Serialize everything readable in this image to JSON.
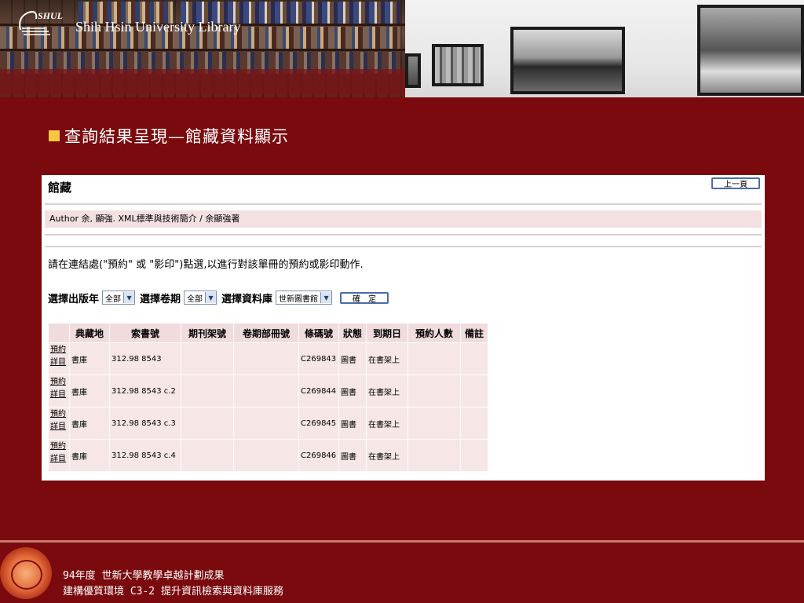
{
  "banner": {
    "library_name": "Shih Hsin University Library",
    "logo_text": "SHUL"
  },
  "heading": "查詢結果呈現—館藏資料顯示",
  "panel": {
    "title": "館藏",
    "prev_button": "上一頁",
    "author_line": "Author 余, 顯強.  XML標準與技術簡介 / 余顯強著",
    "instruction": "請在連結處(\"預約\" 或 \"影印\")點選,以進行對該單冊的預約或影印動作.",
    "filters": {
      "year_label": "選擇出版年",
      "year_value": "全部",
      "volume_label": "選擇卷期",
      "volume_value": "全部",
      "database_label": "選擇資料庫",
      "database_value": "世新圖書館",
      "ok_button": "確　定"
    },
    "table": {
      "headers": [
        "",
        "典藏地",
        "索書號",
        "期刊架號",
        "卷期部冊號",
        "條碼號",
        "狀態",
        "到期日",
        "預約人數",
        "備註"
      ],
      "rows": [
        {
          "reserve": "預約",
          "detail": "詳目",
          "location": "書庫",
          "call_no": "312.98 8543",
          "shelf": "",
          "volume": "",
          "barcode": "C269843",
          "type": "圖書",
          "status": "在書架上",
          "holds": "",
          "note": ""
        },
        {
          "reserve": "預約",
          "detail": "詳目",
          "location": "書庫",
          "call_no": "312.98 8543 c.2",
          "shelf": "",
          "volume": "",
          "barcode": "C269844",
          "type": "圖書",
          "status": "在書架上",
          "holds": "",
          "note": ""
        },
        {
          "reserve": "預約",
          "detail": "詳目",
          "location": "書庫",
          "call_no": "312.98 8543 c.3",
          "shelf": "",
          "volume": "",
          "barcode": "C269845",
          "type": "圖書",
          "status": "在書架上",
          "holds": "",
          "note": ""
        },
        {
          "reserve": "預約",
          "detail": "詳目",
          "location": "書庫",
          "call_no": "312.98 8543 c.4",
          "shelf": "",
          "volume": "",
          "barcode": "C269846",
          "type": "圖書",
          "status": "在書架上",
          "holds": "",
          "note": ""
        }
      ]
    }
  },
  "footer": {
    "line1": "94年度 世新大學教學卓越計劃成果",
    "line2": "建構優質環境 C3-2 提升資訊檢索與資料庫服務"
  },
  "colors": {
    "background": "#7a0a0e",
    "table_header": "#f0dcdc",
    "table_cell": "#f6e6e6",
    "bullet": "#f5c842"
  }
}
